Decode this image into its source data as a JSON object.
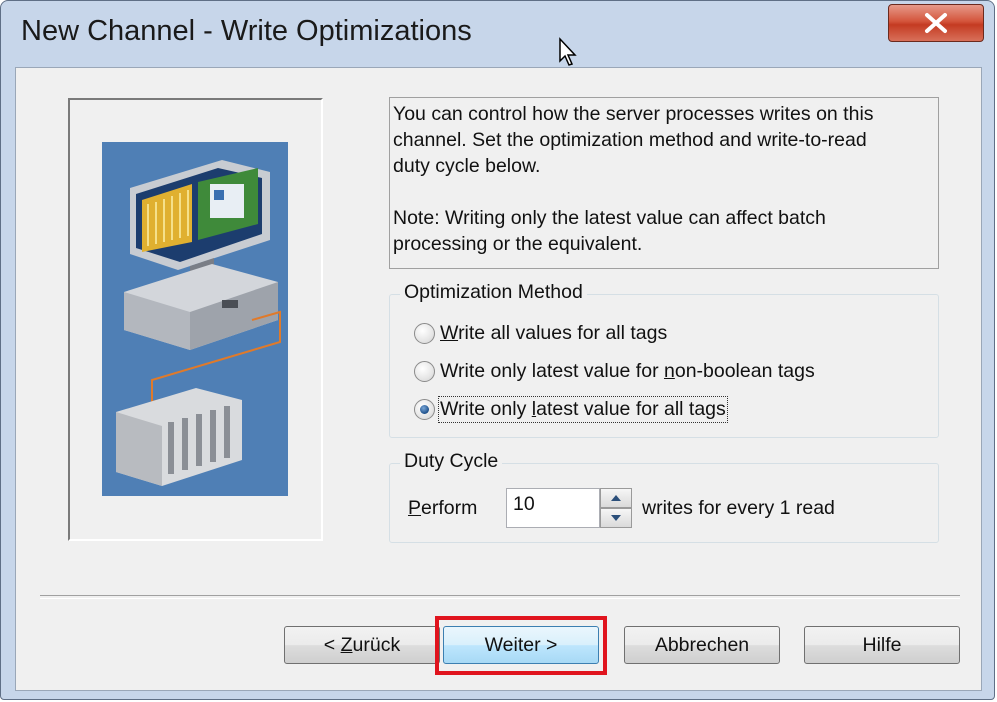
{
  "window": {
    "title": "New Channel - Write Optimizations"
  },
  "info": {
    "line1": "You can control how the server processes writes on this",
    "line2": "channel.  Set the optimization method and write-to-read",
    "line3": "duty cycle below.",
    "note1": "Note:  Writing only the latest value can affect batch",
    "note2": "processing or the equivalent."
  },
  "optimization": {
    "label": "Optimization Method",
    "options": [
      {
        "label_pre": "",
        "label_u": "W",
        "label_post": "rite all values for all tags",
        "checked": false
      },
      {
        "label_pre": "Write only latest value for ",
        "label_u": "n",
        "label_post": "on-boolean tags",
        "checked": false
      },
      {
        "label_pre": "Write only ",
        "label_u": "l",
        "label_post": "atest value for all tags",
        "checked": true
      }
    ]
  },
  "duty_cycle": {
    "label": "Duty Cycle",
    "perform_u": "P",
    "perform_rest": "erform",
    "value": "10",
    "suffix": "writes for every 1 read"
  },
  "buttons": {
    "back_pre": "< ",
    "back_u": "Z",
    "back_post": "urück",
    "next": "Weiter >",
    "cancel": "Abbrechen",
    "help": "Hilfe"
  },
  "colors": {
    "highlight": "#e0141e",
    "illustration_bg": "#4f7fb5"
  }
}
